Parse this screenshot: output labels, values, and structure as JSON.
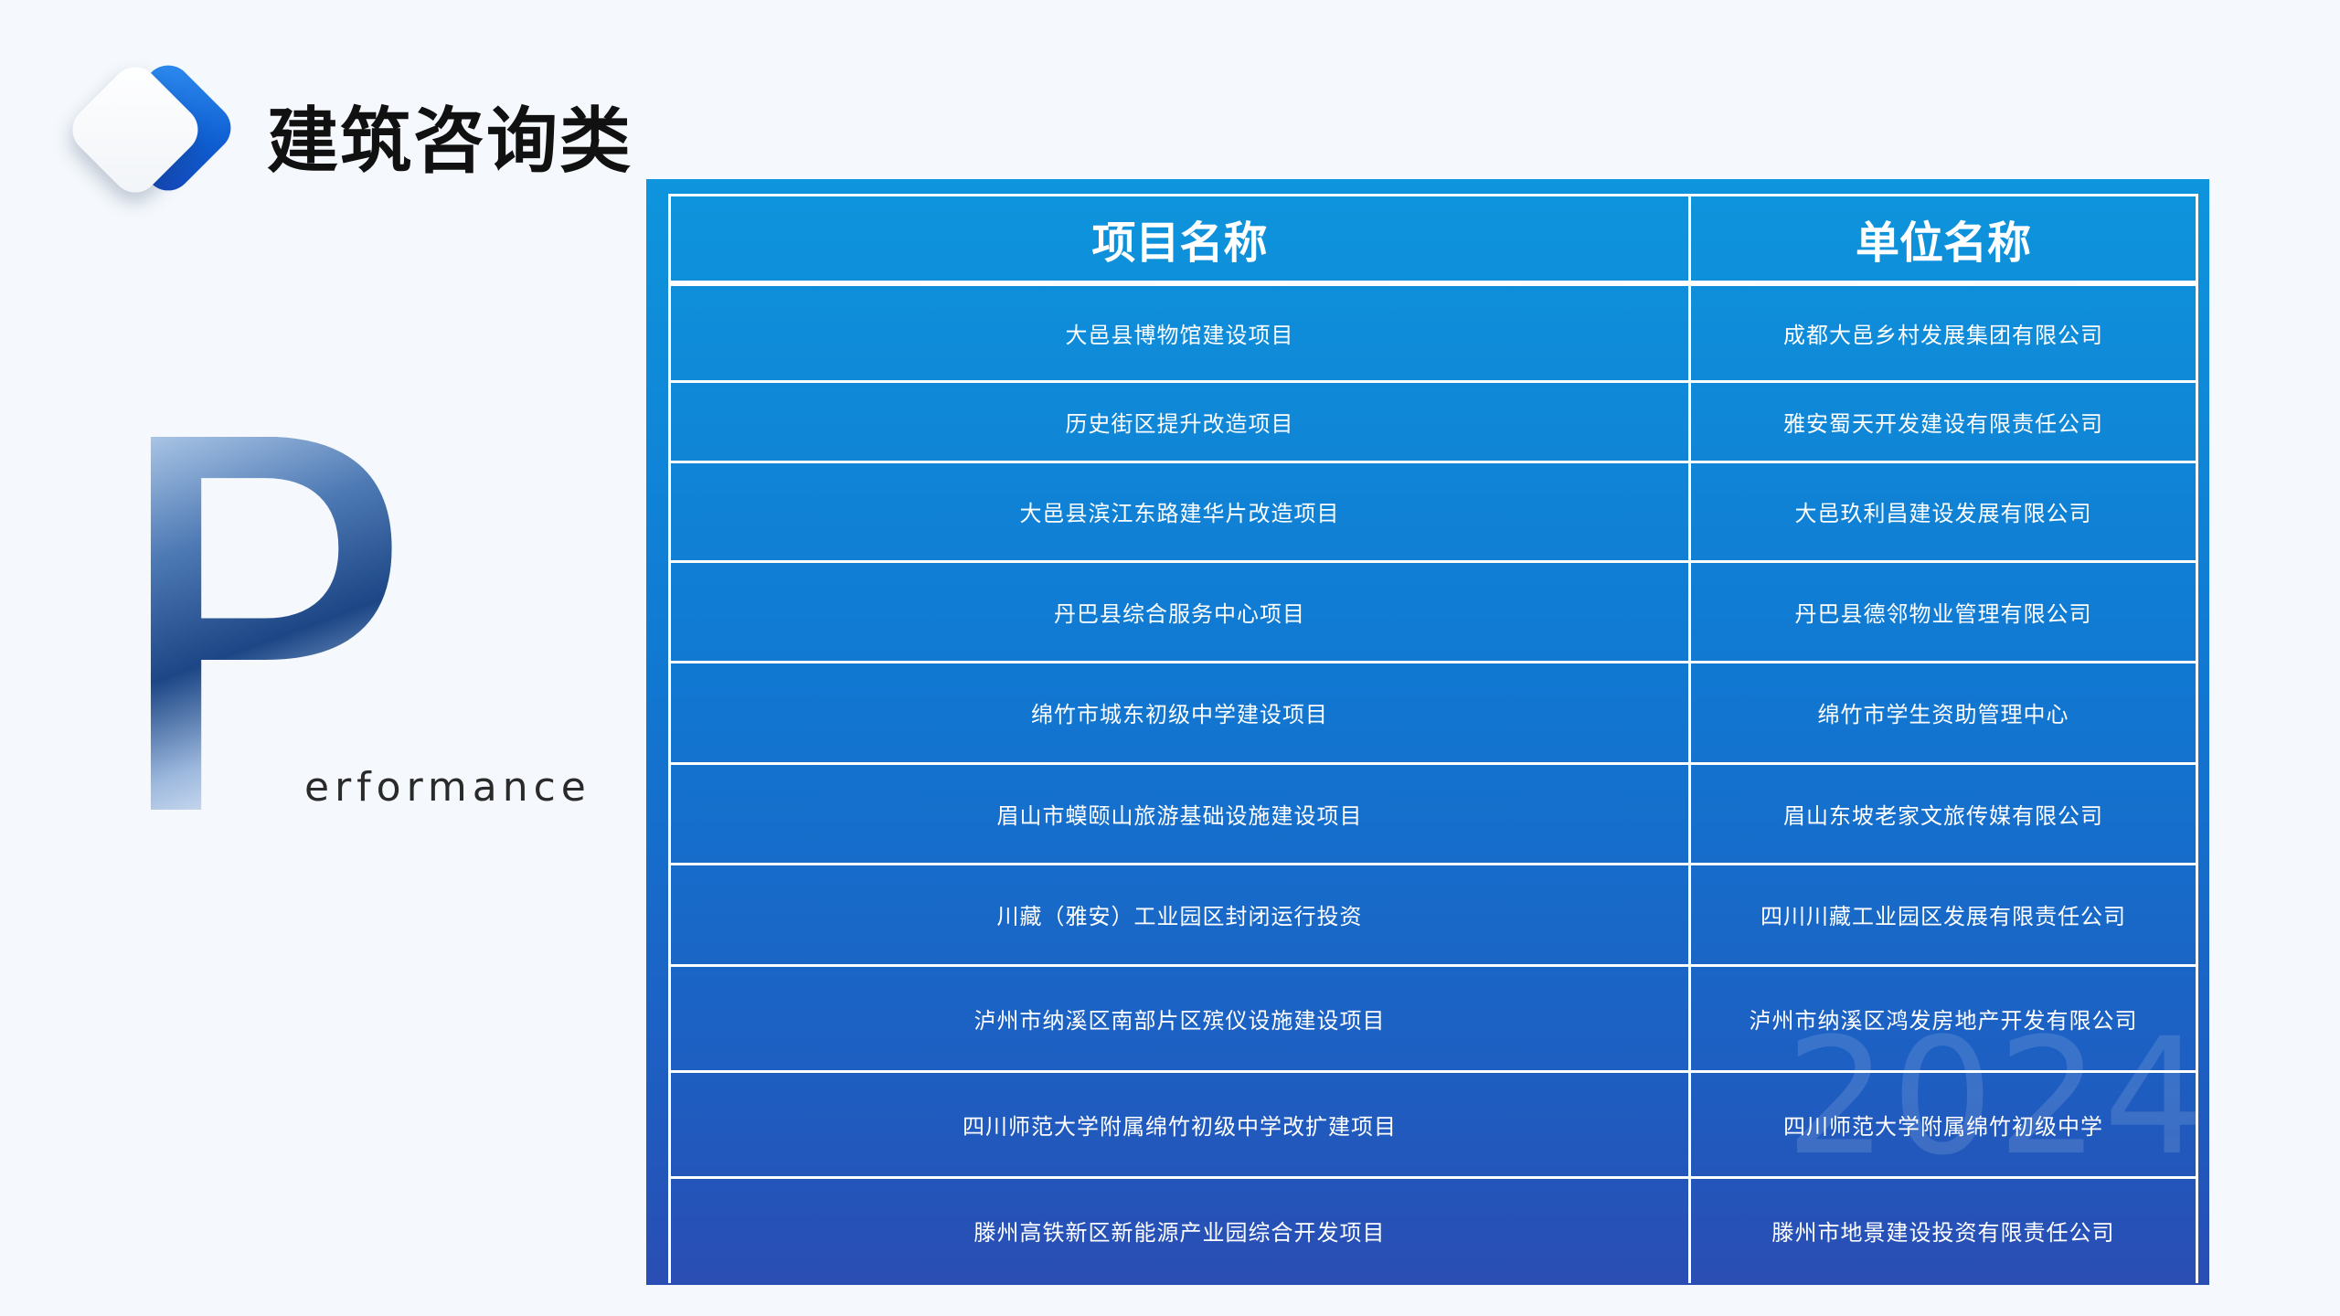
{
  "header": {
    "title": "建筑咨询类"
  },
  "decoration": {
    "big_letter": "P",
    "word_suffix": "erformance",
    "watermark_year": "2024"
  },
  "table": {
    "headers": [
      "项目名称",
      "单位名称"
    ],
    "rows": [
      [
        "大邑县博物馆建设项目",
        "成都大邑乡村发展集团有限公司"
      ],
      [
        "历史街区提升改造项目",
        "雅安蜀天开发建设有限责任公司"
      ],
      [
        "大邑县滨江东路建华片改造项目",
        "大邑玖利昌建设发展有限公司"
      ],
      [
        "丹巴县综合服务中心项目",
        "丹巴县德邻物业管理有限公司"
      ],
      [
        "绵竹市城东初级中学建设项目",
        "绵竹市学生资助管理中心"
      ],
      [
        "眉山市蟆颐山旅游基础设施建设项目",
        "眉山东坡老家文旅传媒有限公司"
      ],
      [
        "川藏（雅安）工业园区封闭运行投资",
        "四川川藏工业园区发展有限责任公司"
      ],
      [
        "泸州市纳溪区南部片区殡仪设施建设项目",
        "泸州市纳溪区鸿发房地产开发有限公司"
      ],
      [
        "四川师范大学附属绵竹初级中学改扩建项目",
        "四川师范大学附属绵竹初级中学"
      ],
      [
        "滕州高铁新区新能源产业园综合开发项目",
        "滕州市地景建设投资有限责任公司"
      ]
    ]
  },
  "colors": {
    "panel_top": "#0e95dc",
    "panel_bottom": "#2a4db3",
    "logo_blue": "#0f5fd3",
    "title": "#111111"
  }
}
